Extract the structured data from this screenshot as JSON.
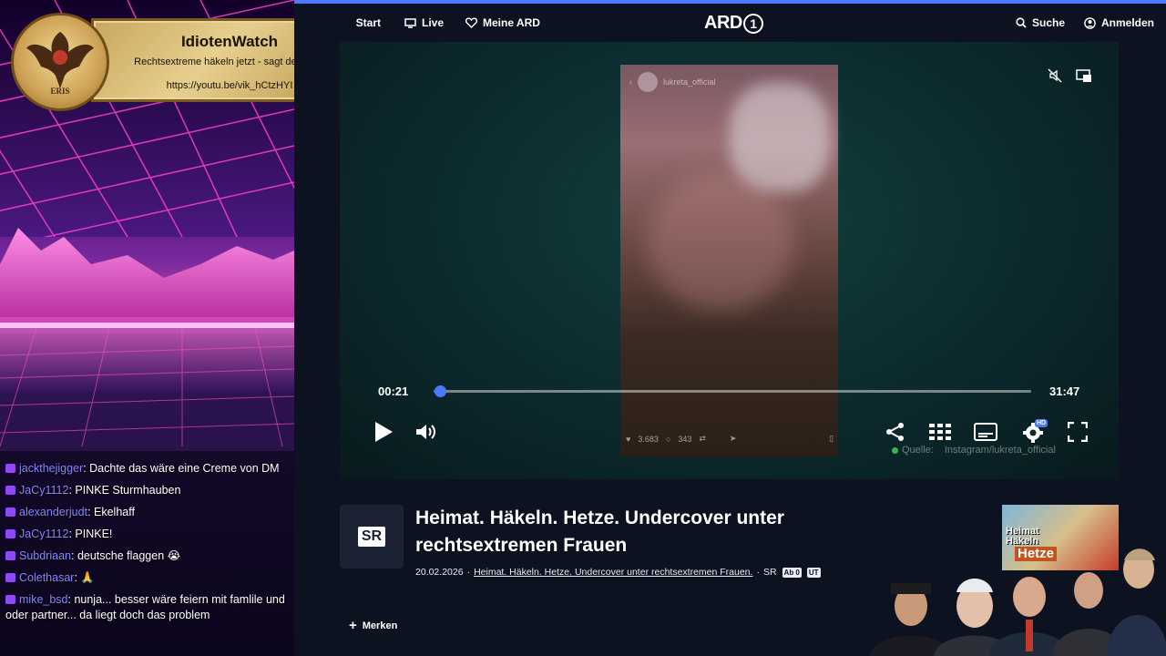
{
  "banner": {
    "title": "IdiotenWatch",
    "subtitle": "Rechtsextreme häkeln jetzt - sagt der ÖRR",
    "url": "https://youtu.be/vik_hCtzHYI",
    "logo_text": "ERIS"
  },
  "chat": [
    {
      "user": "jackthejigger",
      "text": "Dachte das wäre eine Creme von DM"
    },
    {
      "user": "JaCy1112",
      "text": "PINKE Sturmhauben"
    },
    {
      "user": "alexanderjudt",
      "text": "Ekelhaff"
    },
    {
      "user": "JaCy1112",
      "text": "PINKE!"
    },
    {
      "user": "Subdriaan",
      "text": "deutsche flaggen 😭"
    },
    {
      "user": "Colethasar",
      "text": "🙏"
    },
    {
      "user": "mike_bsd",
      "text": "nunja... besser wäre feiern mit famlile und oder partner... da liegt doch das problem"
    }
  ],
  "nav": {
    "start": "Start",
    "live": "Live",
    "meine_ard": "Meine ARD",
    "logo": "ARD",
    "logo_one": "1",
    "search": "Suche",
    "login": "Anmelden"
  },
  "player": {
    "current_time": "00:21",
    "duration": "31:47",
    "progress": 0.011,
    "source_label": "Quelle:",
    "source_value": "Instagram/lukreta_official",
    "ig_account": "lukreta_official",
    "ig_likes": "3.683",
    "ig_comments": "343",
    "hd_badge": "HD"
  },
  "program": {
    "channel_logo": "SR",
    "title": "Heimat. Häkeln. Hetze. Undercover unter rechtsextremen Frauen",
    "date": "20.02.2026",
    "separator": "·",
    "series_link": "Heimat. Häkeln. Hetze. Undercover unter rechtsextremen Frauen.",
    "channel": "SR",
    "tag_ab": "Ab 0",
    "tag_ut": "UT",
    "merken": "Merken"
  },
  "thumbnail": {
    "line1": "Heimat",
    "line2": "Häkeln",
    "line3": "Hetze"
  },
  "colors": {
    "accent": "#4d79ff",
    "page_bg": "#0d1220",
    "chat_user": "#8b84ff"
  }
}
